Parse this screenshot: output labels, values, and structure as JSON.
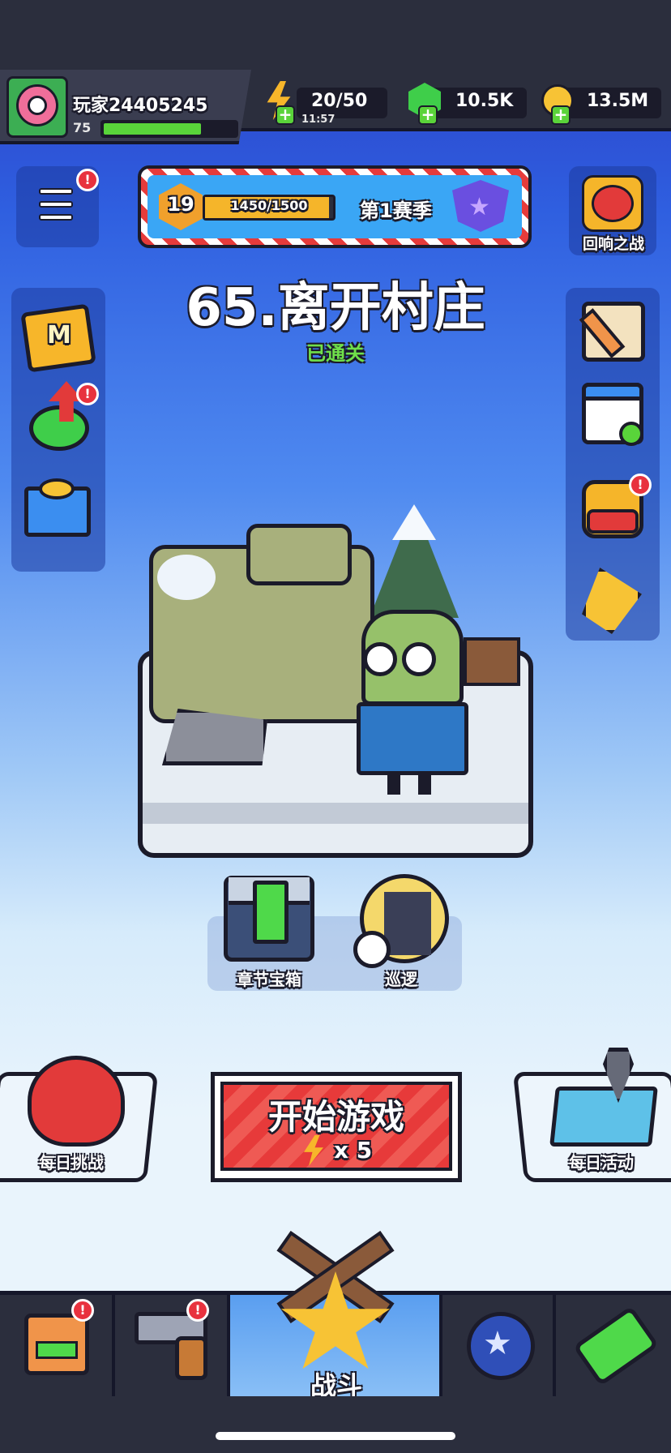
{
  "player": {
    "name": "玩家24405245",
    "level": "75",
    "xp_fraction": 0.74
  },
  "resources": {
    "energy": "20/50",
    "energy_timer": "11:57",
    "gems": "10.5K",
    "coins": "13.5M",
    "plus_symbol": "+"
  },
  "season": {
    "level": "19",
    "progress": "1450/1500",
    "progress_fraction": 0.967,
    "label": "第1赛季",
    "star": "★"
  },
  "echo_battle": {
    "label": "回响之战"
  },
  "stage": {
    "title": "65.离开村庄",
    "status": "已通关"
  },
  "actions": {
    "chapter_chest": "章节宝箱",
    "patrol": "巡逻",
    "daily_challenge": "每日挑战",
    "start_game": "开始游戏",
    "start_cost": "x 5",
    "daily_event": "每日活动"
  },
  "nav": {
    "battle": "战斗",
    "talent_star": "★"
  },
  "badge_symbol": "!",
  "colors": {
    "badge_red": "#e8323e",
    "start_red": "#e73a3a",
    "accent_green": "#4fd94a",
    "gold": "#f7c335"
  },
  "icons": {
    "menu": "menu-icon",
    "map_m": "M",
    "shop": "shop-icon",
    "weapon": "revolver-icon",
    "battle": "star-icon",
    "talents": "planet-icon",
    "evolution": "dna-icon"
  }
}
